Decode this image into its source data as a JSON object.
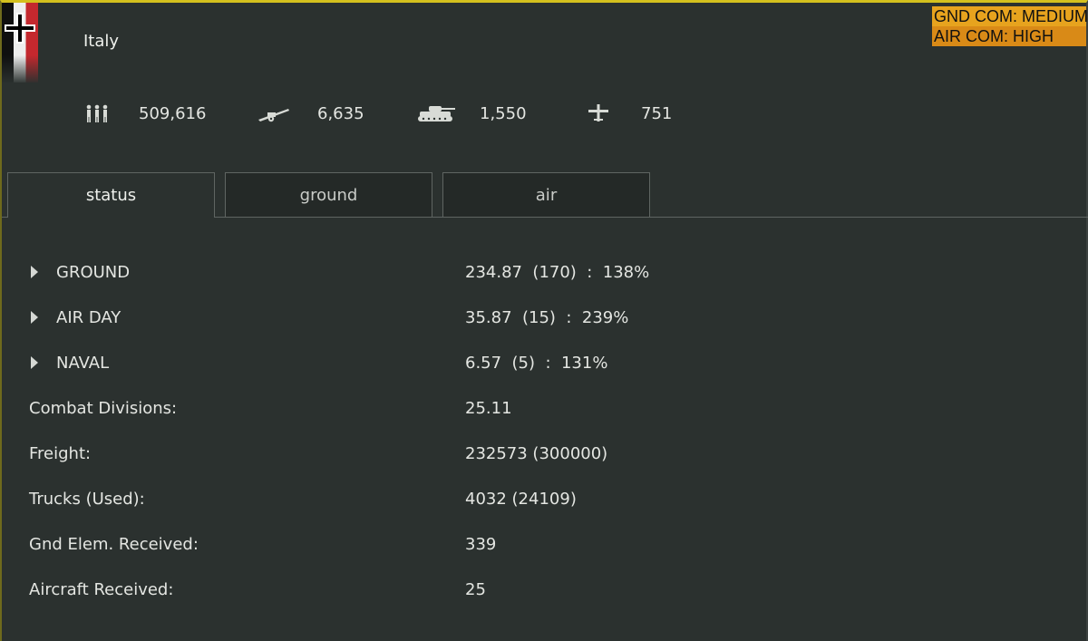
{
  "header": {
    "nation": "Italy",
    "gnd_com": "GND COM: MEDIUM",
    "air_com": "AIR COM: HIGH",
    "colors": {
      "border": "#d4c01e",
      "comm_bg": "#e29a1c",
      "panel_bg": "#2b312f"
    }
  },
  "stats": [
    {
      "icon": "infantry-icon",
      "value": "509,616"
    },
    {
      "icon": "artillery-icon",
      "value": "6,635"
    },
    {
      "icon": "tank-icon",
      "value": "1,550"
    },
    {
      "icon": "aircraft-icon",
      "value": "751"
    }
  ],
  "tabs": [
    {
      "label": "status",
      "active": true
    },
    {
      "label": "ground",
      "active": false
    },
    {
      "label": "air",
      "active": false
    }
  ],
  "rows": [
    {
      "label": "GROUND",
      "value": "234.87  (170)  :  138%",
      "expandable": true
    },
    {
      "label": "AIR DAY",
      "value": "35.87  (15)  :  239%",
      "expandable": true
    },
    {
      "label": "NAVAL",
      "value": "6.57  (5)  :  131%",
      "expandable": true
    },
    {
      "label": "Combat Divisions:",
      "value": "25.11",
      "expandable": false
    },
    {
      "label": "Freight:",
      "value": "232573 (300000)",
      "expandable": false
    },
    {
      "label": "Trucks (Used):",
      "value": "4032 (24109)",
      "expandable": false
    },
    {
      "label": "Gnd Elem. Received:",
      "value": "339",
      "expandable": false
    },
    {
      "label": "Aircraft Received:",
      "value": "25",
      "expandable": false
    }
  ]
}
